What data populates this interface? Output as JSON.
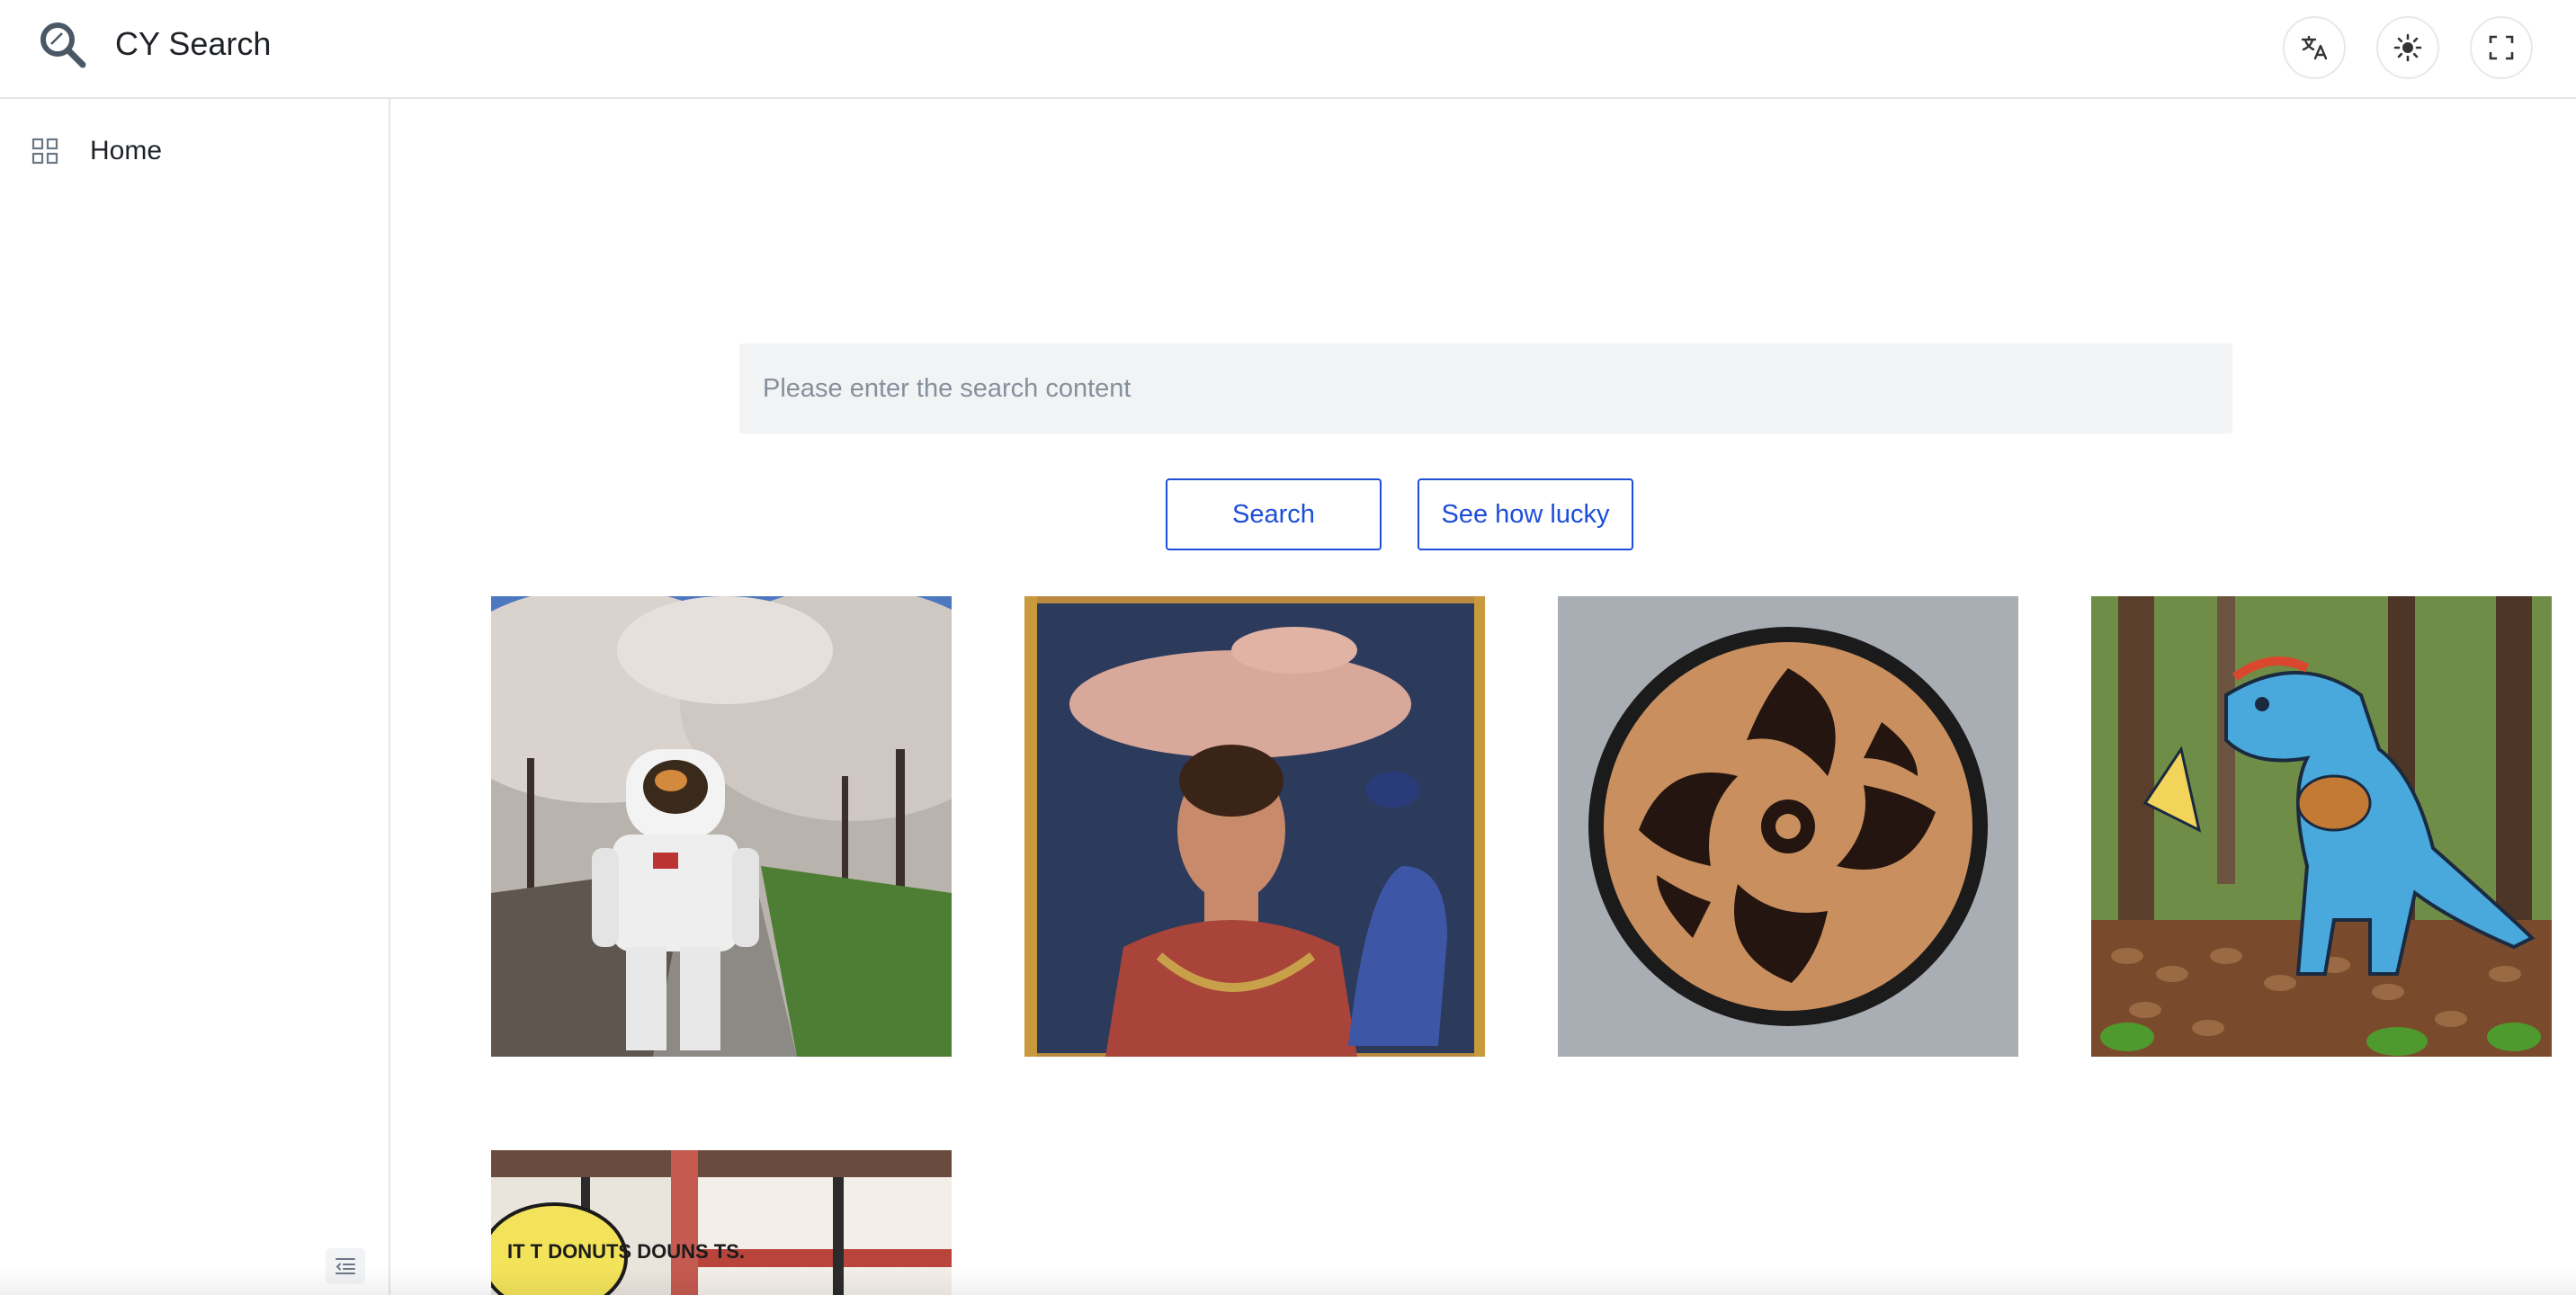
{
  "header": {
    "title": "CY Search",
    "logo_icon": "magnifier-logo-icon",
    "buttons": [
      {
        "icon": "translate-icon"
      },
      {
        "icon": "theme-sun-icon"
      },
      {
        "icon": "fullscreen-icon"
      }
    ]
  },
  "sidebar": {
    "items": [
      {
        "label": "Home",
        "icon": "grid-icon"
      }
    ],
    "collapse_icon": "collapse-menu-icon"
  },
  "search": {
    "placeholder": "Please enter the search content",
    "value": ""
  },
  "actions": {
    "search_label": "Search",
    "lucky_label": "See how lucky"
  },
  "results": {
    "images": [
      {
        "subject": "astronaut-cherry-blossoms"
      },
      {
        "subject": "man-with-reptiles-painting"
      },
      {
        "subject": "carved-wooden-disc"
      },
      {
        "subject": "blue-dinosaur-with-food"
      },
      {
        "subject": "donut-shop-cartoon",
        "caption": "IT T DONUTS DOUNS TS."
      }
    ]
  },
  "colors": {
    "accent": "#1d4ed8",
    "border": "#e3e5e8",
    "input_bg": "#f2f3f5"
  }
}
